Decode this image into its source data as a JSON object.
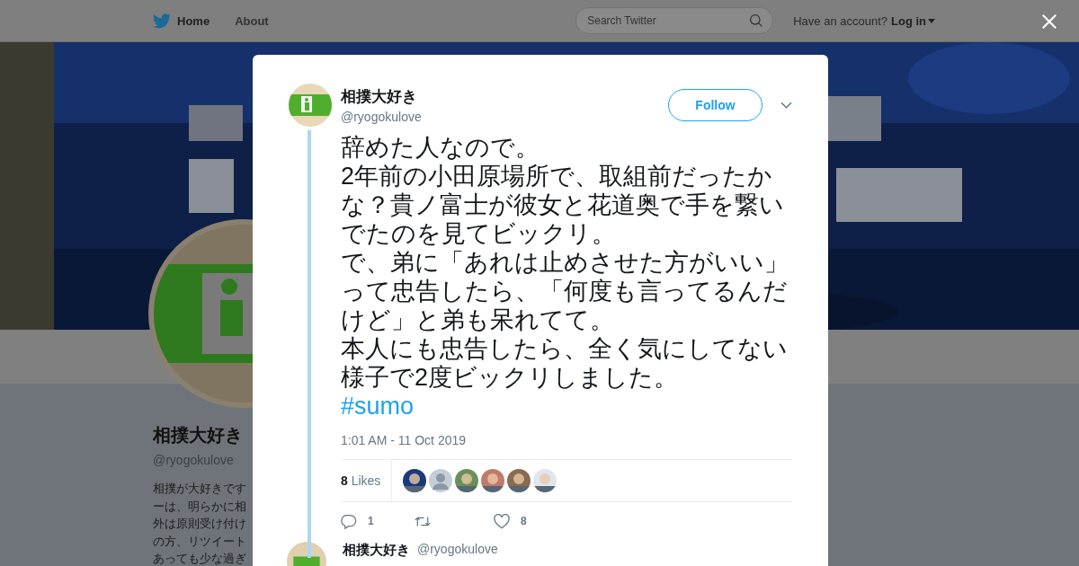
{
  "nav": {
    "items": [
      {
        "label": "Home",
        "selected": true
      },
      {
        "label": "About",
        "selected": false
      }
    ],
    "search": {
      "placeholder": "Search Twitter"
    },
    "account_prompt": "Have an account?",
    "login": "Log in"
  },
  "profile": {
    "name": "相撲大好き",
    "handle": "@ryogokulove",
    "bio_lines": [
      "相撲が大好きです",
      "ーは、明らかに相",
      "外は原則受け付け",
      "の方、リツイート",
      "あっても少な過ぎ"
    ]
  },
  "tweet": {
    "name": "相撲大好き",
    "handle": "@ryogokulove",
    "follow": "Follow",
    "paragraphs": [
      "辞めた人なので。",
      "2年前の小田原場所で、取組前だったかな？貴ノ富士が彼女と花道奥で手を繋いでたのを見てビックリ。",
      "で、弟に「あれは止めさせた方がいい」って忠告したら、「何度も言ってるんだけど」と弟も呆れてて。",
      "本人にも忠告したら、全く気にしてない様子で2度ビックリしました。"
    ],
    "hashtag": "#sumo",
    "time": "1:01 AM - 11 Oct 2019",
    "likes_count": "8",
    "likes_label": "Likes",
    "likers": [
      {
        "kind": "picture"
      },
      {
        "kind": "default"
      },
      {
        "kind": "picture"
      },
      {
        "kind": "picture"
      },
      {
        "kind": "picture"
      },
      {
        "kind": "picture"
      }
    ],
    "replies": "1",
    "like_total": "8"
  },
  "next_reply": {
    "name": "相撲大好き",
    "handle": "@ryogokulove"
  }
}
